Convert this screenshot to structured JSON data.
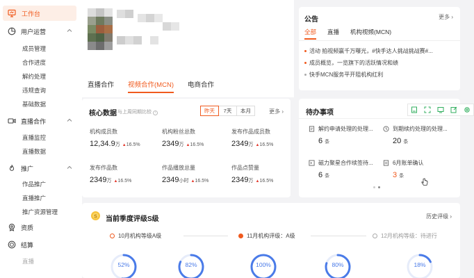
{
  "sidebar": {
    "top": {
      "label": "工作台"
    },
    "groups": [
      {
        "label": "用户运营",
        "items": [
          "成员管理",
          "合作进度",
          "解约处理",
          "违规查询",
          "基础数据"
        ]
      },
      {
        "label": "直播合作",
        "items": [
          "直播监控",
          "直播数据"
        ]
      },
      {
        "label": "推广",
        "items": [
          "作品推广",
          "直播推广",
          "推广资源管理"
        ]
      },
      {
        "label": "资质",
        "items": []
      },
      {
        "label": "结算",
        "items": [
          "直播"
        ]
      }
    ]
  },
  "main_tabs": [
    "直播合作",
    "视频合作(MCN)",
    "电商合作"
  ],
  "notice": {
    "title": "公告",
    "more": "更多",
    "tabs": [
      "全部",
      "直播",
      "机构视频(MCN)"
    ],
    "items": [
      "活动 拍视频赢千万曝光，#快手达人挑战挑战赛#...",
      "成员概览，一览旗下的活跃情况和绩",
      "快手MCN服务平开阻机构红利"
    ]
  },
  "core": {
    "title": "核心数据",
    "subtitle": "与上周同期比较",
    "segments": [
      "昨天",
      "7天",
      "本月"
    ],
    "more": "更多",
    "metrics": [
      {
        "label": "机构成员数",
        "value": "12,34.9",
        "unit": "万",
        "change": "16.5%"
      },
      {
        "label": "机构粉丝总数",
        "value": "2349",
        "unit": "万",
        "change": "16.5%"
      },
      {
        "label": "发布作品成员数",
        "value": "2349",
        "unit": "万",
        "change": "16.5%"
      },
      {
        "label": "发布作品数",
        "value": "2349",
        "unit": "万",
        "change": "16.5%"
      },
      {
        "label": "作品播放总量",
        "value": "2349",
        "unit": "小时",
        "change": "16.5%"
      },
      {
        "label": "作品点赞量",
        "value": "2349",
        "unit": "万",
        "change": "16.5%"
      }
    ]
  },
  "todo": {
    "title": "待办事项",
    "items": [
      {
        "label": "解约申请处理的处理...",
        "value": "6",
        "unit": "条",
        "icon": "document-icon"
      },
      {
        "label": "到期续约处理的处理...",
        "value": "20",
        "unit": "条",
        "icon": "clock-icon"
      },
      {
        "label": "磁力聚星合作续签待...",
        "value": "6",
        "unit": "条",
        "icon": "contract-icon"
      },
      {
        "label": "6月账单确认",
        "value": "3",
        "unit": "条",
        "icon": "bill-icon"
      }
    ]
  },
  "rating": {
    "title": "当前季度评级S级",
    "history": "历史评级",
    "steps": [
      {
        "label": "10月机构等级A级"
      },
      {
        "label": "11月机构评级：A级"
      },
      {
        "label": "12月机构等级：待进行"
      }
    ],
    "gauges": [
      {
        "label": "52%",
        "value": 52
      },
      {
        "label": "82%",
        "value": 82
      },
      {
        "label": "100%",
        "value": 100
      },
      {
        "label": "80%",
        "value": 80
      },
      {
        "label": "18%",
        "value": 18
      }
    ]
  },
  "colors": {
    "accent": "#f05a1e",
    "gauge": "#4a7be8",
    "toolbar": "#2fae5c"
  }
}
